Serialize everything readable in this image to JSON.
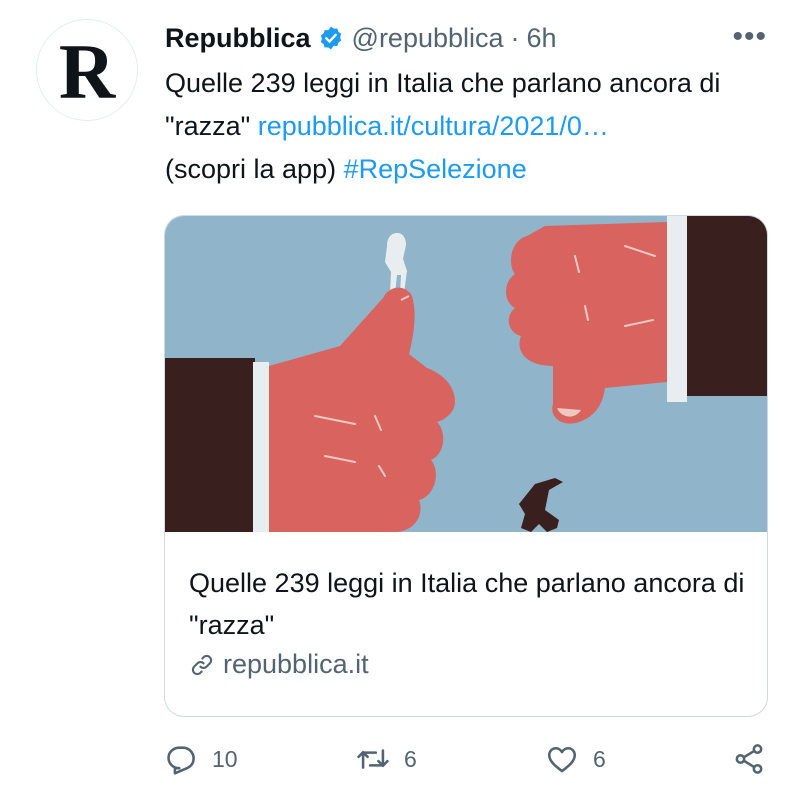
{
  "tweet": {
    "author_name": "Repubblica",
    "handle": "@repubblica",
    "separator": "·",
    "time": "6h",
    "more": "•••",
    "avatar_letter": "R",
    "text_part1": "Quelle 239 leggi in Italia che parlano ancora di \"razza\" ",
    "link_text": "repubblica.it/cultura/2021/0…",
    "text_part2": "(scopri la app) ",
    "hashtag": "#RepSelezione"
  },
  "card": {
    "title": "Quelle 239 leggi in Italia che parlano ancora di \"razza\"",
    "domain": "repubblica.it"
  },
  "actions": {
    "reply_count": "10",
    "retweet_count": "6",
    "like_count": "6"
  },
  "colors": {
    "accent": "#1d9bf0",
    "secondary_text": "#536471",
    "image_background": "#90b4c9",
    "hand_red": "#d9645f",
    "sleeve_dark": "#3a1f1f"
  }
}
